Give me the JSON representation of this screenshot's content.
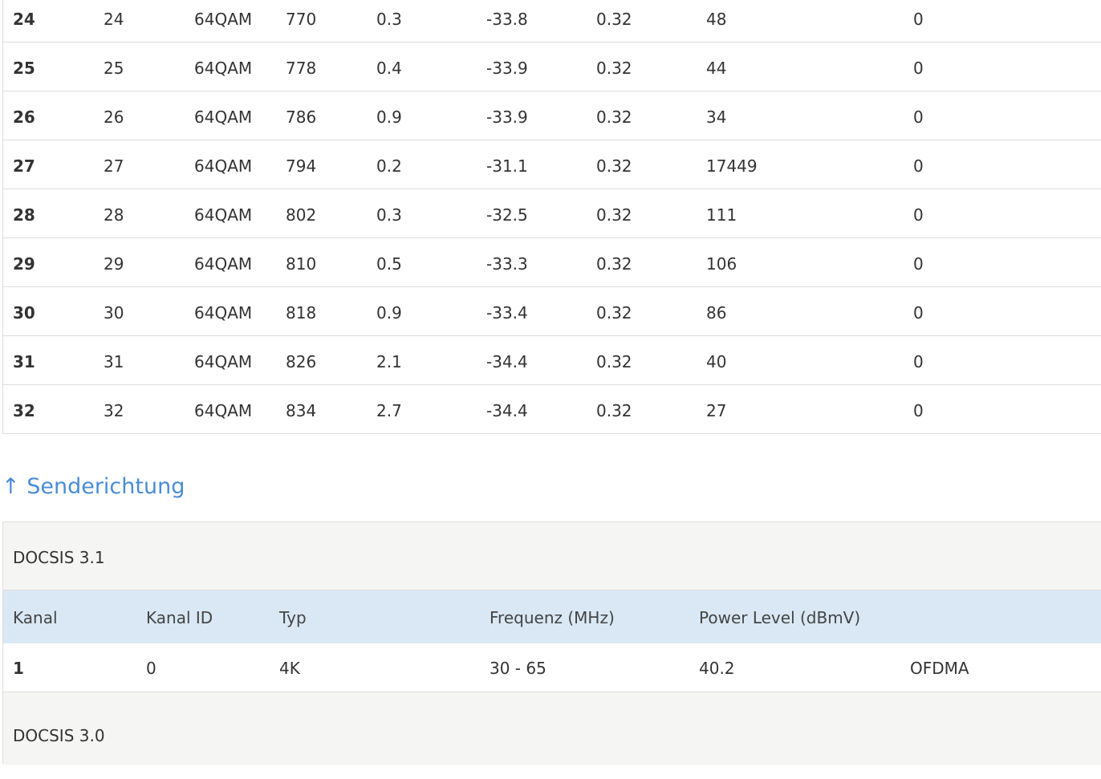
{
  "downstream": {
    "rows": [
      [
        "24",
        "24",
        "64QAM",
        "770",
        "0.3",
        "-33.8",
        "0.32",
        "48",
        "0"
      ],
      [
        "25",
        "25",
        "64QAM",
        "778",
        "0.4",
        "-33.9",
        "0.32",
        "44",
        "0"
      ],
      [
        "26",
        "26",
        "64QAM",
        "786",
        "0.9",
        "-33.9",
        "0.32",
        "34",
        "0"
      ],
      [
        "27",
        "27",
        "64QAM",
        "794",
        "0.2",
        "-31.1",
        "0.32",
        "17449",
        "0"
      ],
      [
        "28",
        "28",
        "64QAM",
        "802",
        "0.3",
        "-32.5",
        "0.32",
        "111",
        "0"
      ],
      [
        "29",
        "29",
        "64QAM",
        "810",
        "0.5",
        "-33.3",
        "0.32",
        "106",
        "0"
      ],
      [
        "30",
        "30",
        "64QAM",
        "818",
        "0.9",
        "-33.4",
        "0.32",
        "86",
        "0"
      ],
      [
        "31",
        "31",
        "64QAM",
        "826",
        "2.1",
        "-34.4",
        "0.32",
        "40",
        "0"
      ],
      [
        "32",
        "32",
        "64QAM",
        "834",
        "2.7",
        "-34.4",
        "0.32",
        "27",
        "0"
      ]
    ]
  },
  "upstream": {
    "heading": "↑ Senderichtung",
    "docsis31_label": "DOCSIS 3.1",
    "docsis30_label": "DOCSIS 3.0",
    "columns": [
      "Kanal",
      "Kanal ID",
      "Typ",
      "Frequenz (MHz)",
      "Power Level (dBmV)"
    ],
    "rows": [
      [
        "1",
        "0",
        "4K",
        "30 - 65",
        "40.2",
        "OFDMA"
      ]
    ]
  }
}
